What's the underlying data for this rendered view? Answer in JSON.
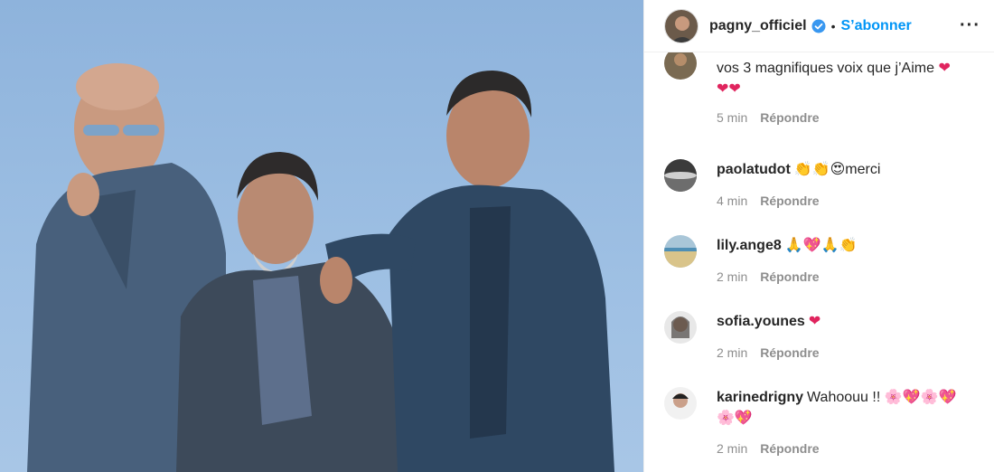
{
  "header": {
    "username": "pagny_officiel",
    "separator": "•",
    "follow_label": "S’abonner",
    "more_label": "···"
  },
  "comments": [
    {
      "username": "",
      "text_line1": "vos 3 magnifiques voix que j’Aime",
      "emoji_line1": "❤",
      "emoji_line2": "❤❤",
      "time": "5 min",
      "reply": "Répondre"
    },
    {
      "username": "paolatudot",
      "emoji": "👏👏😍",
      "text": "merci",
      "time": "4 min",
      "reply": "Répondre"
    },
    {
      "username": "lily.ange8",
      "emoji": "🙏💖🙏👏",
      "time": "2 min",
      "reply": "Répondre"
    },
    {
      "username": "sofia.younes",
      "emoji": "❤",
      "time": "2 min",
      "reply": "Répondre"
    },
    {
      "username": "karinedrigny",
      "text": "Wahoouu !!",
      "emoji_line1": "🌸💖🌸💖",
      "emoji_line2": "🌸💖",
      "time": "2 min",
      "reply": "Répondre"
    }
  ],
  "colors": {
    "accent": "#0095f6",
    "verified": "#3897f0",
    "meta": "#8e8e8e",
    "photo_background": "#9dbfe3"
  },
  "icons": {
    "verified": "verified-badge-icon",
    "more": "more-options-icon"
  }
}
